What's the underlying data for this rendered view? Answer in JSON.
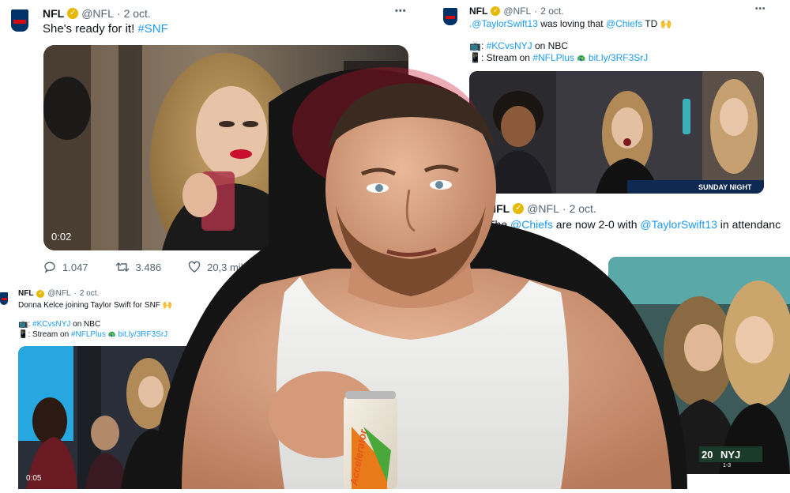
{
  "tweet_main": {
    "account": "NFL",
    "handle": "@NFL",
    "date": "2 oct.",
    "text_prefix": "She's ready for it! ",
    "hashtag": "#SNF",
    "video_time": "0:02",
    "replies": "1.047",
    "retweets": "3.486",
    "likes": "20,3 mil",
    "more": "•••"
  },
  "tweet_right": {
    "account": "NFL",
    "handle": "@NFL",
    "date": "2 oct.",
    "mention1": ".@TaylorSwift13",
    "text_mid": " was loving that ",
    "mention2": "@Chiefs",
    "text_end": " TD 🙌",
    "line2_hashtag": "#KCvsNYJ",
    "line2_suffix": " on NBC",
    "line3_prefix": ": Stream on ",
    "line3_hashtag": "#NFLPlus",
    "line3_link": "bit.ly/3RF3SrJ",
    "more": "•••"
  },
  "tweet_mid_right": {
    "account": "NFL",
    "handle": "@NFL",
    "date": "2 oct.",
    "text_prefix": "The ",
    "mention1": "@Chiefs",
    "text_mid": " are now 2-0 with ",
    "mention2": "@TaylorSwift13",
    "text_end": " in attendanc"
  },
  "tweet_bottom_left": {
    "account": "NFL",
    "handle": "@NFL",
    "date": "2 oct.",
    "text": "Donna Kelce joining Taylor Swift for SNF 🙌",
    "line2_hashtag": "#KCvsNYJ",
    "line2_suffix": " on NBC",
    "line3_prefix": ": Stream on ",
    "line3_hashtag": "#NFLPlus",
    "line3_link": "bit.ly/3RF3SrJ",
    "video_time": "0:05"
  },
  "overlay": {
    "can_text": "Accelerator",
    "score_left": "20",
    "score_team": "NYJ",
    "score_sub": "1-3",
    "banner_text": "SUNDAY NIGHT"
  }
}
